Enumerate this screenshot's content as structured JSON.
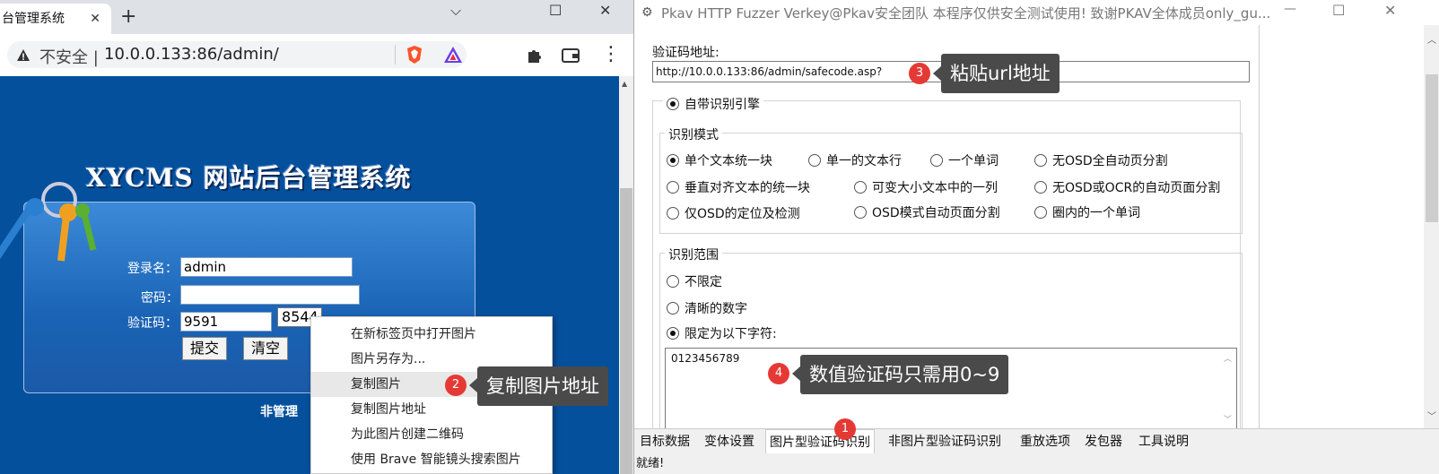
{
  "browser": {
    "tab_title": "台管理系统",
    "tab_close": "✕",
    "new_tab": "+",
    "win_min": "⌵",
    "win_max": "☐",
    "win_close": "✕",
    "insecure_label": "不安全 |",
    "url": "10.0.0.133:86/admin/",
    "menu_glyph": "⋮"
  },
  "cms": {
    "title": "XYCMS 网站后台管理系统",
    "username_label": "登录名：",
    "username_value": "admin",
    "password_label": "密码：",
    "password_value": "",
    "code_label": "验证码：",
    "code_value": "9591",
    "code_image_text": "8544",
    "submit_label": "提交",
    "clear_label": "清空",
    "footer_text": "非管理"
  },
  "context_menu": {
    "items": [
      "在新标签页中打开图片",
      "图片另存为...",
      "复制图片",
      "复制图片地址",
      "为此图片创建二维码",
      "使用 Brave 智能镜头搜索图片"
    ]
  },
  "callouts": {
    "c1": {
      "num": "1"
    },
    "c2": {
      "num": "2",
      "text": "复制图片地址"
    },
    "c3": {
      "num": "3",
      "text": "粘贴url地址"
    },
    "c4": {
      "num": "4",
      "text": "数值验证码只需用0~9"
    }
  },
  "fuzzer": {
    "title": "Pkav HTTP Fuzzer  Verkey@Pkav安全团队  本程序仅供安全测试使用!  致谢PKAV全体成员only_gu...",
    "win_min": "—",
    "win_max": "☐",
    "win_close": "✕",
    "captcha_url_label": "验证码地址:",
    "captcha_url_value": "http://10.0.0.133:86/admin/safecode.asp?",
    "engine_label": "自带识别引擎",
    "mode_group_label": "识别模式",
    "modes": [
      "单个文本统一块",
      "单一的文本行",
      "一个单词",
      "无OSD全自动页分割",
      "垂直对齐文本的统一块",
      "可变大小文本中的一列",
      "无OSD或OCR的自动页面分割",
      "仅OSD的定位及检测",
      "OSD模式自动页面分割",
      "圈内的一个单词"
    ],
    "range_group_label": "识别范围",
    "ranges": [
      "不限定",
      "清晰的数字",
      "限定为以下字符:"
    ],
    "chars_value": "0123456789",
    "tabs": [
      "目标数据",
      "变体设置",
      "图片型验证码识别",
      "非图片型验证码识别",
      "重放选项",
      "发包器",
      "工具说明"
    ],
    "status": "就绪!"
  },
  "colors": {
    "page_blue": "#05509c",
    "callout_bg": "#4a4a4a",
    "badge_red": "#e53935"
  }
}
